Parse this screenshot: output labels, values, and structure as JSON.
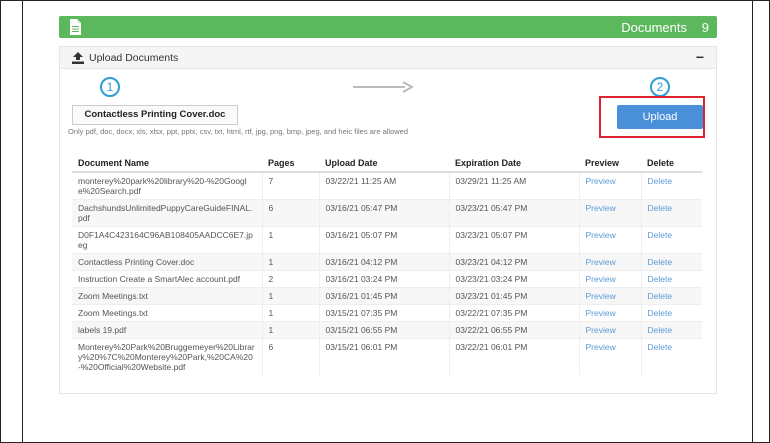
{
  "banner": {
    "title": "Documents",
    "count": "9",
    "color": "#5cb85c",
    "icon": "document-icon"
  },
  "panel": {
    "header_label": "Upload Documents",
    "header_icon": "upload-icon",
    "collapse_symbol": "−"
  },
  "steps": {
    "step1": "1",
    "step2": "2"
  },
  "upload": {
    "selected_file": "Contactless Printing Cover.doc",
    "hint": "Only pdf, doc, docx, xls, xlsx, ppt, pptx, csv, txt, html, rtf, jpg, png, bmp, jpeg, and heic files are allowed",
    "button_label": "Upload",
    "button_color": "#4a90d9",
    "highlight_color": "#d9232e"
  },
  "table": {
    "headers": [
      "Document Name",
      "Pages",
      "Upload Date",
      "Expiration Date",
      "Preview",
      "Delete"
    ],
    "rows": [
      {
        "name": "monterey%20park%20library%20-%20Google%20Search.pdf",
        "pages": "7",
        "uploaded": "03/22/21 11:25 AM",
        "expires": "03/29/21 11:25 AM",
        "preview": "Preview",
        "delete": "Delete"
      },
      {
        "name": "DachshundsUnlimitedPuppyCareGuideFINAL.pdf",
        "pages": "6",
        "uploaded": "03/16/21 05:47 PM",
        "expires": "03/23/21 05:47 PM",
        "preview": "Preview",
        "delete": "Delete"
      },
      {
        "name": "D0F1A4C423164C96AB108405AADCC6E7.jpeg",
        "pages": "1",
        "uploaded": "03/16/21 05:07 PM",
        "expires": "03/23/21 05:07 PM",
        "preview": "Preview",
        "delete": "Delete"
      },
      {
        "name": "Contactless Printing Cover.doc",
        "pages": "1",
        "uploaded": "03/16/21 04:12 PM",
        "expires": "03/23/21 04:12 PM",
        "preview": "Preview",
        "delete": "Delete"
      },
      {
        "name": "Instruction Create a SmartAlec account.pdf",
        "pages": "2",
        "uploaded": "03/16/21 03:24 PM",
        "expires": "03/23/21 03:24 PM",
        "preview": "Preview",
        "delete": "Delete"
      },
      {
        "name": "Zoom Meetings.txt",
        "pages": "1",
        "uploaded": "03/16/21 01:45 PM",
        "expires": "03/23/21 01:45 PM",
        "preview": "Preview",
        "delete": "Delete"
      },
      {
        "name": "Zoom Meetings.txt",
        "pages": "1",
        "uploaded": "03/15/21 07:35 PM",
        "expires": "03/22/21 07:35 PM",
        "preview": "Preview",
        "delete": "Delete"
      },
      {
        "name": "labels 19.pdf",
        "pages": "1",
        "uploaded": "03/15/21 06:55 PM",
        "expires": "03/22/21 06:55 PM",
        "preview": "Preview",
        "delete": "Delete"
      },
      {
        "name": "Monterey%20Park%20Bruggemeyer%20Library%20%7C%20Monterey%20Park,%20CA%20-%20Official%20Website.pdf",
        "pages": "6",
        "uploaded": "03/15/21 06:01 PM",
        "expires": "03/22/21 06:01 PM",
        "preview": "Preview",
        "delete": "Delete"
      }
    ]
  }
}
